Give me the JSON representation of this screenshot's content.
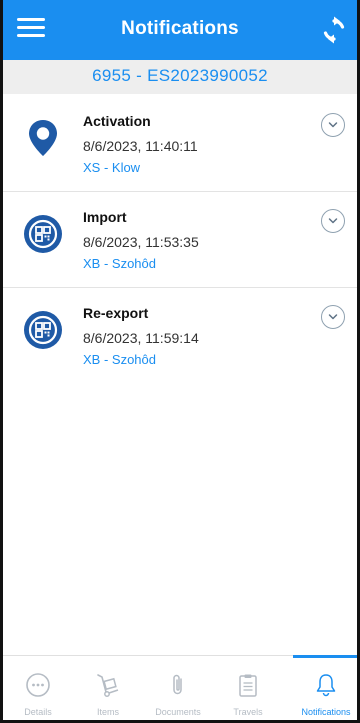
{
  "appbar": {
    "title": "Notifications",
    "menu_icon": "hamburger-menu-icon",
    "refresh_icon": "refresh-icon"
  },
  "subheader": {
    "text": "6955 - ES2023990052"
  },
  "notifications": [
    {
      "icon": "location-pin-icon",
      "title": "Activation",
      "timestamp": "8/6/2023, 11:40:11",
      "detail": "XS - Klow"
    },
    {
      "icon": "qr-code-icon",
      "title": "Import",
      "timestamp": "8/6/2023, 11:53:35",
      "detail": "XB - Szohôd"
    },
    {
      "icon": "qr-code-icon",
      "title": "Re-export",
      "timestamp": "8/6/2023, 11:59:14",
      "detail": "XB - Szohôd"
    }
  ],
  "tabs": [
    {
      "label": "Details",
      "icon": "ellipsis-circle-icon",
      "active": false
    },
    {
      "label": "Items",
      "icon": "hand-truck-icon",
      "active": false
    },
    {
      "label": "Documents",
      "icon": "paperclip-icon",
      "active": false
    },
    {
      "label": "Travels",
      "icon": "clipboard-icon",
      "active": false
    },
    {
      "label": "Notifications",
      "icon": "bell-icon",
      "active": true
    }
  ],
  "colors": {
    "primary": "#1a8ef0",
    "icon_dark": "#1f5aa6",
    "subheader_bg": "#eeeeee",
    "inactive_tab": "#b5bcc4"
  }
}
